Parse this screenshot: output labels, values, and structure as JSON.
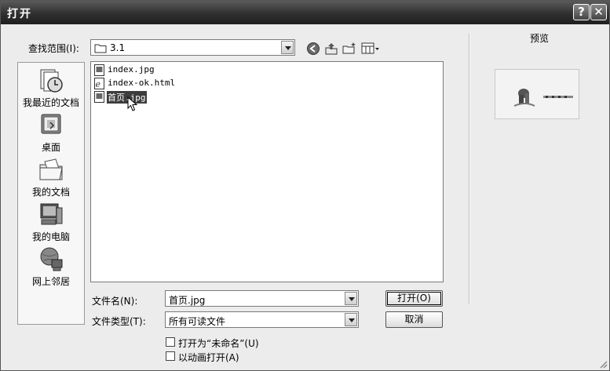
{
  "window": {
    "title": "打开",
    "help_glyph": "?",
    "close_glyph": "✕"
  },
  "lookin": {
    "label": "查找范围(I):",
    "value": "3.1"
  },
  "toolbar": [
    "back-icon",
    "up-folder-icon",
    "new-folder-icon",
    "view-menu-icon"
  ],
  "places": [
    {
      "label": "我最近的文档",
      "icon": "recent-documents-icon"
    },
    {
      "label": "桌面",
      "icon": "desktop-icon"
    },
    {
      "label": "我的文档",
      "icon": "my-documents-icon"
    },
    {
      "label": "我的电脑",
      "icon": "my-computer-icon"
    },
    {
      "label": "网上邻居",
      "icon": "network-places-icon"
    }
  ],
  "files": [
    {
      "name": "index.jpg",
      "icon": "jpg-file-icon",
      "selected": false
    },
    {
      "name": "index-ok.html",
      "icon": "html-file-icon",
      "selected": false
    },
    {
      "name": "首页.jpg",
      "icon": "jpg-file-icon",
      "selected": true
    }
  ],
  "filename": {
    "label": "文件名(N):",
    "value": "首页.jpg"
  },
  "filetype": {
    "label": "文件类型(T):",
    "value": "所有可读文件"
  },
  "buttons": {
    "open": "打开(O)",
    "cancel": "取消"
  },
  "options": {
    "open_untitled": "打开为“未命名”(U)",
    "open_animated": "以动画打开(A)"
  },
  "preview": {
    "label": "预览"
  },
  "colors": {
    "selection": "#3d3d3d",
    "titlebar": "#2e2e2e"
  }
}
